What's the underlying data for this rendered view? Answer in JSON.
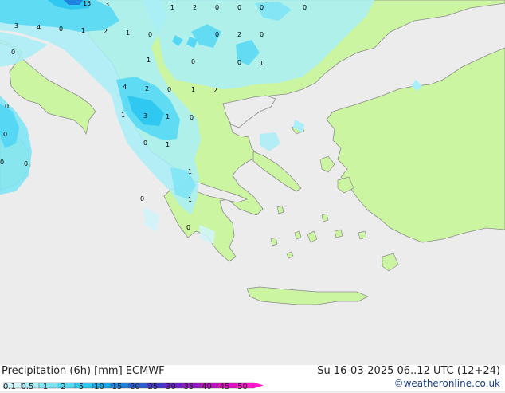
{
  "product": {
    "title": "Precipitation (6h) [mm] ECMWF",
    "valid_time": "Su 16-03-2025 06..12 UTC (12+24)",
    "credit": "©weatheronline.co.uk"
  },
  "legend": {
    "ticks": [
      "0.1",
      "0.5",
      "1",
      "2",
      "5",
      "10",
      "15",
      "20",
      "25",
      "30",
      "35",
      "40",
      "45",
      "50"
    ],
    "colors": [
      "#d0f5fb",
      "#a9eef8",
      "#7fe4f6",
      "#56d8f4",
      "#2fc8f0",
      "#17a8ea",
      "#1e82e0",
      "#2a5fd6",
      "#4038cc",
      "#6a22c8",
      "#9418c6",
      "#be12c4",
      "#e10fc4",
      "#ff18d0"
    ]
  },
  "colors": {
    "sea": "#ececec",
    "land": "#ccf5a2",
    "coast": "#8c8c8c"
  },
  "map_labels": [
    "15",
    "3",
    "1",
    "2",
    "0",
    "0",
    "0",
    "0",
    "3",
    "4",
    "0",
    "1",
    "2",
    "1",
    "0",
    "0",
    "2",
    "0",
    "1",
    "0",
    "0",
    "1",
    "0",
    "4",
    "2",
    "0",
    "1",
    "2",
    "3",
    "1",
    "0",
    "1",
    "0",
    "0",
    "1",
    "0",
    "1",
    "0",
    "0"
  ]
}
